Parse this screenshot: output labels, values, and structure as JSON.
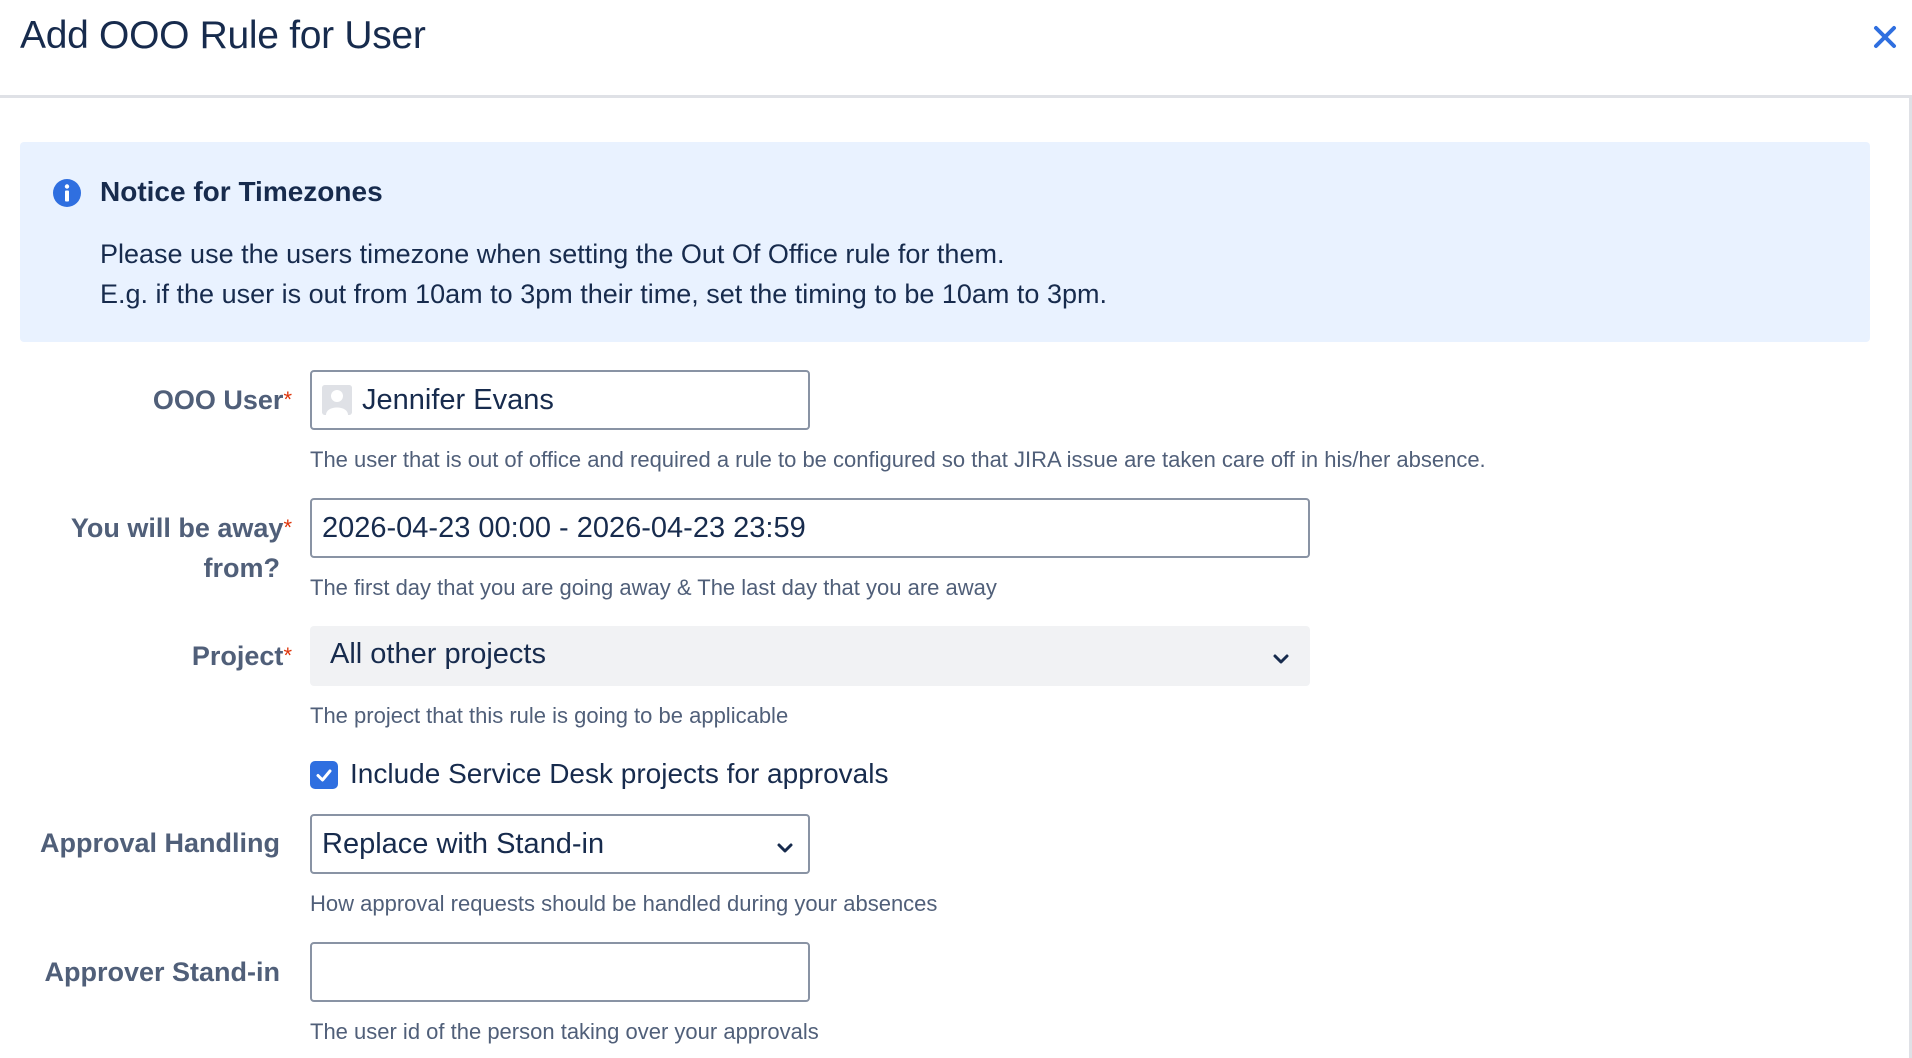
{
  "dialog": {
    "title": "Add OOO Rule for User",
    "close_icon": "close-icon"
  },
  "notice": {
    "icon": "info-icon",
    "title": "Notice for Timezones",
    "line1": "Please use the users timezone when setting the Out Of Office rule for them.",
    "line2": "E.g. if the user is out from 10am to 3pm their time, set the timing to be 10am to 3pm."
  },
  "form": {
    "ooo_user": {
      "label": "OOO User",
      "required": "*",
      "value": "Jennifer Evans",
      "help": "The user that is out of office and required a rule to be configured so that JIRA issue are taken care off in his/her absence."
    },
    "away": {
      "label_line1": "You will be away",
      "label_line2": "from?",
      "required": "*",
      "value": "2026-04-23 00:00 - 2026-04-23 23:59",
      "help": "The first day that you are going away & The last day that you are away"
    },
    "project": {
      "label": "Project",
      "required": "*",
      "value": "All other projects",
      "help": "The project that this rule is going to be applicable"
    },
    "service_desk": {
      "checked": true,
      "label": "Include Service Desk projects for approvals"
    },
    "approval_handling": {
      "label": "Approval Handling",
      "value": "Replace with Stand-in",
      "help": "How approval requests should be handled during your absences"
    },
    "stand_in": {
      "label": "Approver Stand-in",
      "value": "",
      "help": "The user id of the person taking over your approvals"
    }
  },
  "colors": {
    "accent": "#2f6fe0",
    "notice_bg": "#e9f2ff",
    "required": "#de350b"
  }
}
